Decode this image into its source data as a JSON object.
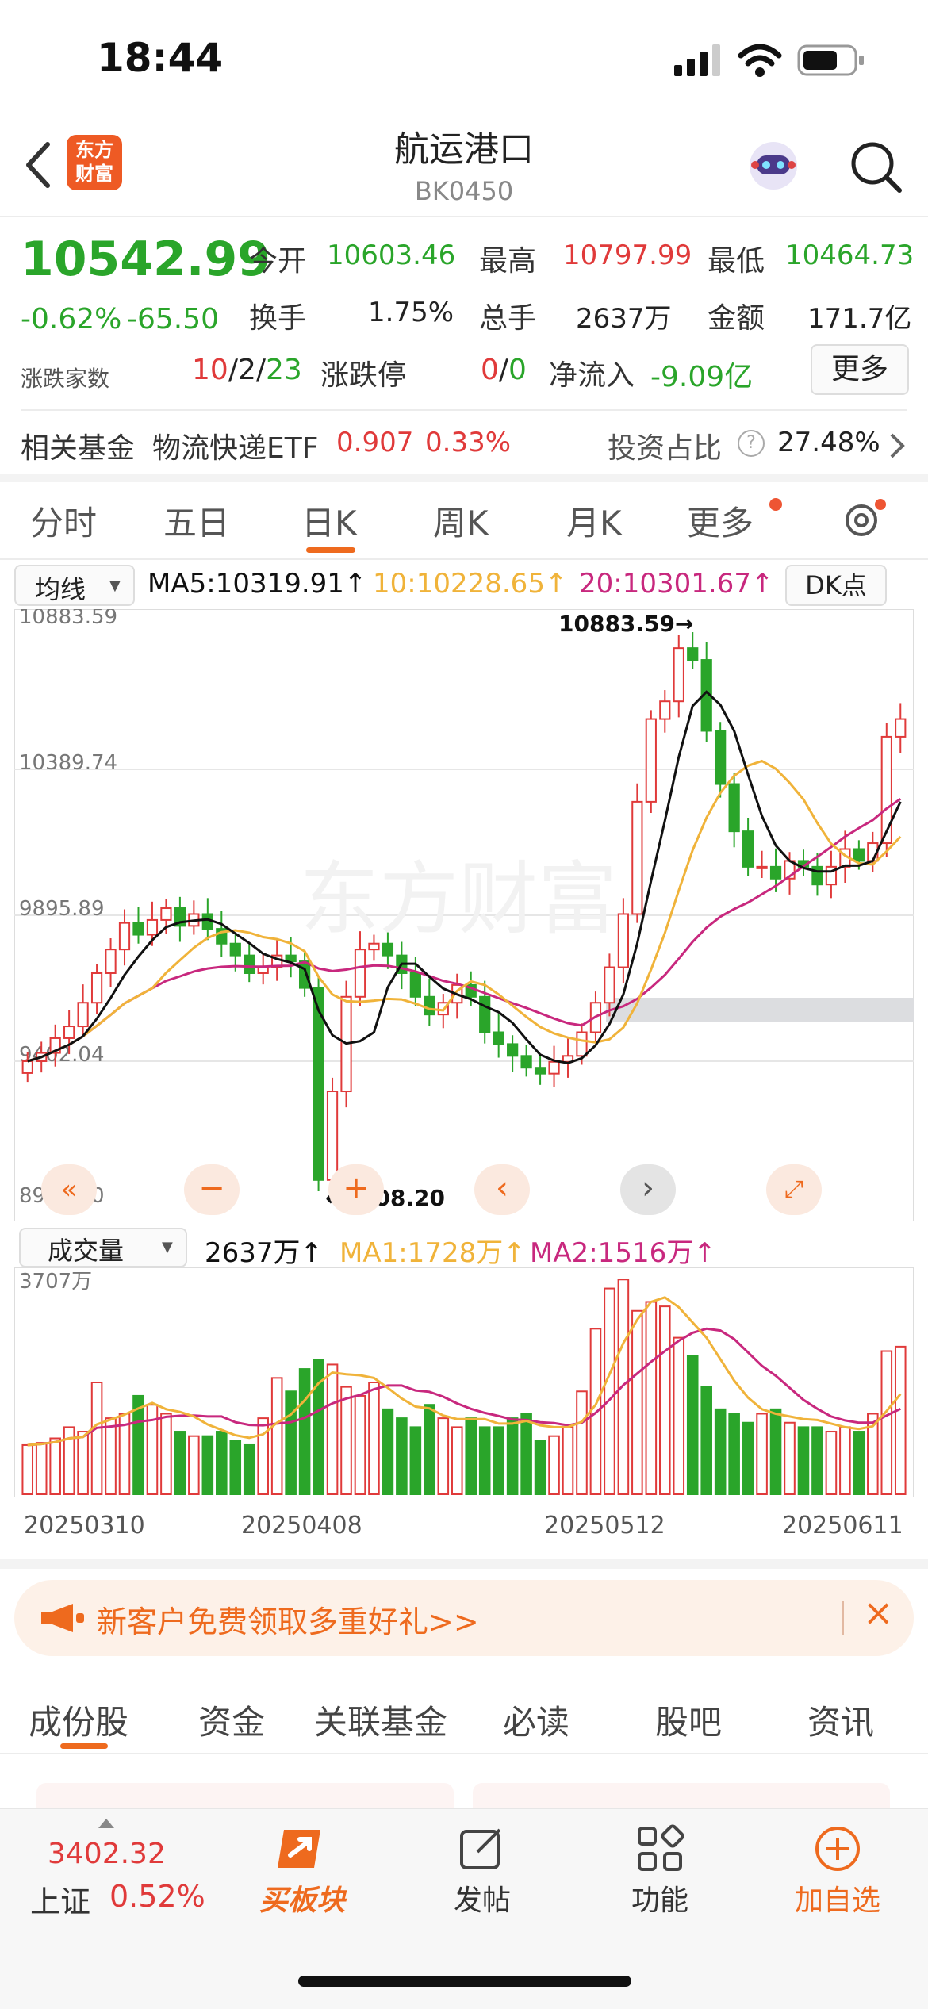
{
  "status": {
    "time": "18:44"
  },
  "nav": {
    "logo_line1": "东方",
    "logo_line2": "财富",
    "title": "航运港口",
    "code": "BK0450"
  },
  "quote": {
    "price": "10542.99",
    "change_pct": "-0.62%",
    "change_abs": "-65.50",
    "open_label": "今开",
    "open": "10603.46",
    "high_label": "最高",
    "high": "10797.99",
    "low_label": "最低",
    "low": "10464.73",
    "turnover_label": "换手",
    "turnover": "1.75%",
    "volume_label": "总手",
    "volume": "2637万",
    "amount_label": "金额",
    "amount": "171.7亿",
    "breadth_label": "涨跌家数",
    "up": "10",
    "flat": "2",
    "down": "23",
    "limit_label": "涨跌停",
    "limit_up": "0",
    "limit_down": "0",
    "netflow_label": "净流入",
    "netflow": "-9.09亿",
    "more": "更多"
  },
  "fund": {
    "label": "相关基金",
    "name": "物流快递ETF",
    "price": "0.907",
    "pct": "0.33%",
    "ratio_label": "投资占比",
    "ratio": "27.48%"
  },
  "ktabs": [
    "分时",
    "五日",
    "日K",
    "周K",
    "月K",
    "更多"
  ],
  "ktab_active": 2,
  "ma": {
    "selector": "均线",
    "ma5": "MA5:10319.91↑",
    "ma10": "10:10228.65↑",
    "ma20": "20:10301.67↑",
    "dk": "DK点"
  },
  "chart_data": {
    "type": "candlestick",
    "ylim": [
      8908.2,
      10883.59
    ],
    "y_ticks": [
      "10883.59",
      "10389.74",
      "9895.89",
      "9402.04",
      "8908.20"
    ],
    "high_annotation": "10883.59→",
    "low_annotation": "←8908.20",
    "x_labels": [
      "20250310",
      "20250408",
      "20250512",
      "20250611"
    ],
    "volume": {
      "selector": "成交量",
      "current": "2637万↑",
      "ma1": "MA1:1728万↑",
      "ma2": "MA2:1516万↑",
      "max_label": "3707万"
    },
    "colors": {
      "up": "#e03a3a",
      "down": "#2aa52a",
      "ma5": "#111111",
      "ma10": "#f0b33a",
      "ma20": "#c8287e"
    }
  },
  "banner": {
    "text": "新客户免费领取多重好礼>>"
  },
  "bottom_tabs": [
    "成份股",
    "资金",
    "关联基金",
    "必读",
    "股吧",
    "资讯"
  ],
  "footer": {
    "index_value": "3402.32",
    "index_name": "上证",
    "index_pct": "0.52%",
    "items": [
      "买板块",
      "发帖",
      "功能",
      "加自选"
    ]
  }
}
